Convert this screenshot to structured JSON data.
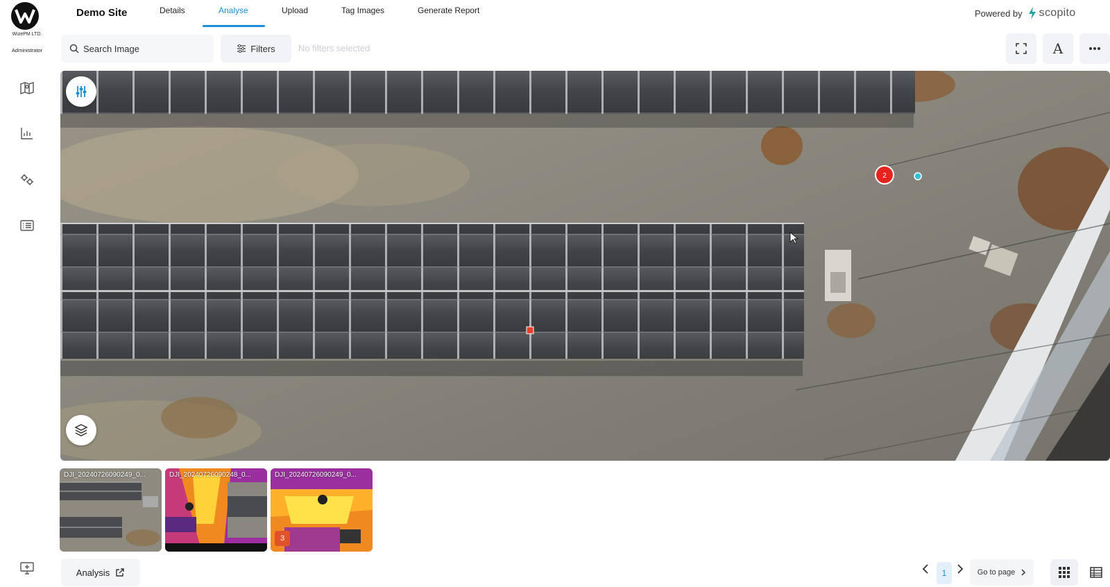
{
  "org": {
    "name": "WizePM LTD.",
    "role": "Administrator"
  },
  "sidebar": {
    "items": [
      {
        "icon": "map-icon"
      },
      {
        "icon": "bar-chart-icon"
      },
      {
        "icon": "settings-gears-icon"
      },
      {
        "icon": "report-list-icon"
      }
    ],
    "bottom_icon": "monitor-add-icon"
  },
  "header": {
    "site_title": "Demo Site",
    "tabs": [
      {
        "label": "Details",
        "active": false
      },
      {
        "label": "Analyse",
        "active": true
      },
      {
        "label": "Upload",
        "active": false
      },
      {
        "label": "Tag Images",
        "active": false
      },
      {
        "label": "Generate Report",
        "active": false
      }
    ],
    "powered_by": "Powered by",
    "brand": "scopito"
  },
  "toolbar": {
    "search_placeholder": "Search Image",
    "filters_label": "Filters",
    "no_filters_text": "No filters selected",
    "font_button_label": "A"
  },
  "viewer": {
    "annotations": [
      {
        "type": "issue-marker",
        "label": "2",
        "color": "#e8231f"
      },
      {
        "type": "point-marker",
        "color": "#2ec4d6"
      },
      {
        "type": "square-marker",
        "color": "#e8402a"
      }
    ]
  },
  "thumbnails": [
    {
      "label": "DJI_20240726090249_0...",
      "kind": "rgb"
    },
    {
      "label": "DJI_20240726090248_0...",
      "kind": "thermal"
    },
    {
      "label": "DJI_20240726090249_0...",
      "kind": "thermal",
      "badge": "3"
    }
  ],
  "footer": {
    "analysis_label": "Analysis",
    "current_page": "1",
    "goto_label": "Go to page"
  },
  "colors": {
    "accent": "#1a8fd8",
    "marker_red": "#e8231f",
    "marker_cyan": "#2ec4d6"
  }
}
